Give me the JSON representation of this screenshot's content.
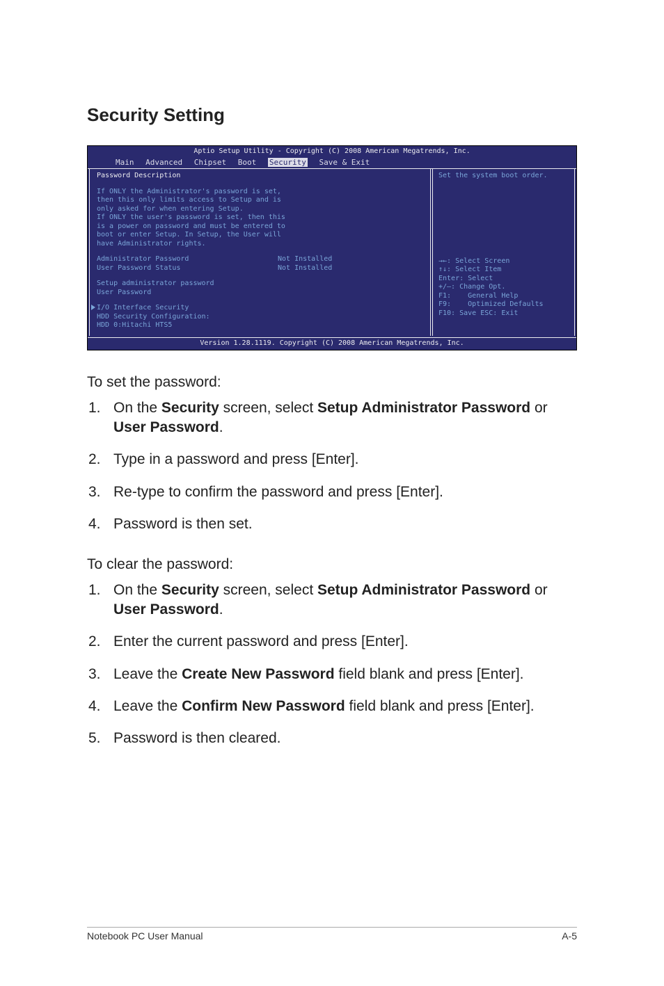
{
  "section_title": "Security Setting",
  "bios": {
    "utility_title": "Aptio Setup Utility - Copyright (C) 2008 American Megatrends, Inc.",
    "menus": {
      "main": "Main",
      "advanced": "Advanced",
      "chipset": "Chipset",
      "boot": "Boot",
      "security": "Security",
      "save_exit": "Save & Exit"
    },
    "left": {
      "heading": "Password Description",
      "desc_lines": [
        "If ONLY the Administrator's password is set,",
        "then this only limits access to Setup and is",
        "only asked for when entering Setup.",
        "If ONLY the user's password is set, then this",
        "is a power on password and must be entered to",
        "boot or enter Setup. In Setup, the User will",
        "have Administrator rights."
      ],
      "admin_pw_label": "Administrator Password",
      "admin_pw_value": "Not Installed",
      "user_pw_status_label": "User Password Status",
      "user_pw_status_value": "Not Installed",
      "setup_admin_pw": "Setup administrator password",
      "user_pw": "User Password",
      "io_interface": "I/O Interface Security",
      "hdd_conf": "HDD Security Configuration:",
      "hdd_item": "HDD 0:Hitachi HTS5"
    },
    "right": {
      "hint": "Set the system boot order.",
      "help_lines": [
        {
          "key": "→←:",
          "text": "Select Screen"
        },
        {
          "key": "↑↓:",
          "text": "Select Item"
        },
        {
          "key": "Enter:",
          "text": "Select"
        },
        {
          "key": "+/—:",
          "text": "Change Opt."
        },
        {
          "key": "F1:",
          "text": "General Help"
        },
        {
          "key": "F9:",
          "text": "Optimized Defaults"
        },
        {
          "key": "F10:",
          "text": "Save    ESC: Exit"
        }
      ]
    },
    "footer": "Version 1.28.1119. Copyright (C) 2008 American Megatrends, Inc."
  },
  "set_pw": {
    "lead": "To set the password:",
    "steps": [
      {
        "n": "1.",
        "prefix": "On the ",
        "b1": "Security",
        "mid": " screen, select ",
        "b2": "Setup Administrator Password",
        "after": " or ",
        "b3": "User Password",
        "tail": "."
      },
      {
        "n": "2.",
        "plain": "Type in a password and press [Enter]."
      },
      {
        "n": "3.",
        "plain": "Re-type to confirm the password and press [Enter]."
      },
      {
        "n": "4.",
        "plain": "Password is then set."
      }
    ]
  },
  "clear_pw": {
    "lead": "To clear the password:",
    "steps": [
      {
        "n": "1.",
        "prefix": "On the ",
        "b1": "Security",
        "mid": " screen, select ",
        "b2": "Setup Administrator Password",
        "after": " or ",
        "b3": "User Password",
        "tail": "."
      },
      {
        "n": "2.",
        "plain": "Enter the current password and press [Enter]."
      },
      {
        "n": "3.",
        "prefix": "Leave the ",
        "b1": "Create New Password",
        "tail": " field blank and press [Enter]."
      },
      {
        "n": "4.",
        "prefix": "Leave the ",
        "b1": "Confirm New Password",
        "tail": " field blank and press [Enter]."
      },
      {
        "n": "5.",
        "plain": "Password is then cleared."
      }
    ]
  },
  "footer": {
    "left": "Notebook PC User Manual",
    "right": "A-5"
  }
}
